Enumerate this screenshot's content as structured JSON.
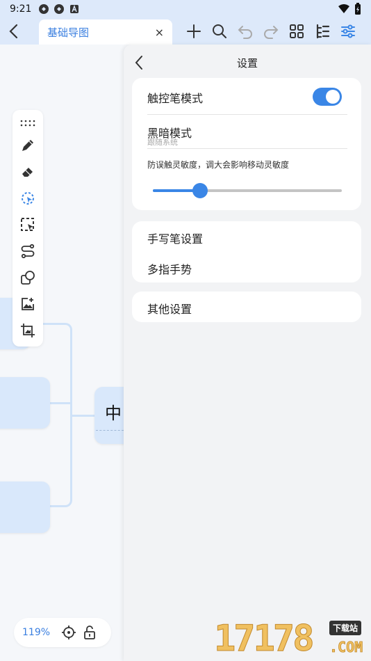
{
  "status_bar": {
    "time": "9:21"
  },
  "toolbar": {
    "tab_title": "基础导图",
    "tab_close": "×"
  },
  "canvas": {
    "center_node_text": "中"
  },
  "zoom": {
    "level": "119%"
  },
  "settings": {
    "title": "设置",
    "stylus_mode_label": "触控笔模式",
    "stylus_mode_on": true,
    "dark_mode_label": "黑暗模式",
    "dark_mode_value": "跟随系统",
    "palm_rejection_label": "防误触灵敏度，调大会影响移动灵敏度",
    "palm_rejection_level": 0.25,
    "stylus_settings_label": "手写笔设置",
    "multi_finger_label": "多指手势",
    "other_settings_label": "其他设置"
  },
  "watermark": {
    "digits": "17178",
    "badge": "下载站",
    "domain": ".COM"
  },
  "colors": {
    "accent": "#3a86e6",
    "node": "#d9e8fb",
    "bar": "#dde9fa"
  }
}
